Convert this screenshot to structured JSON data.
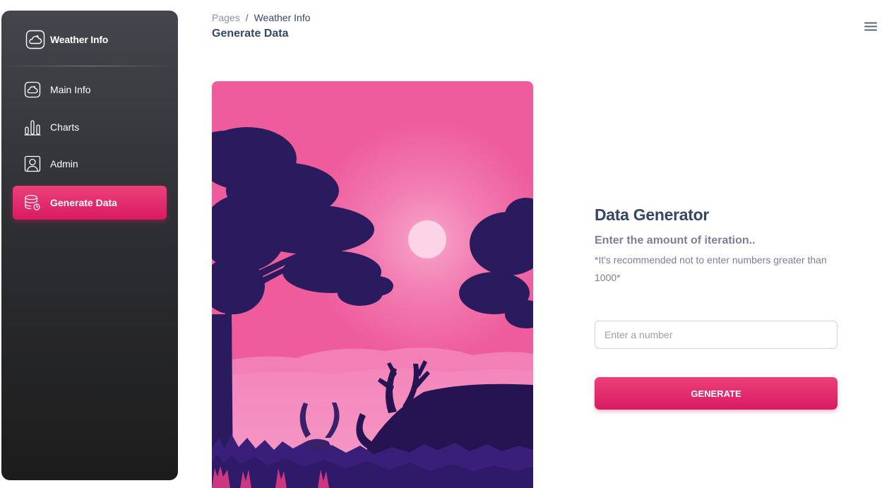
{
  "sidebar": {
    "brand": {
      "label": "Weather Info",
      "icon": "cloud-sun-icon"
    },
    "items": [
      {
        "label": "Main Info",
        "icon": "cloud-icon",
        "active": false
      },
      {
        "label": "Charts",
        "icon": "bar-chart-icon",
        "active": false
      },
      {
        "label": "Admin",
        "icon": "user-icon",
        "active": false
      },
      {
        "label": "Generate Data",
        "icon": "database-icon",
        "active": true
      }
    ]
  },
  "header": {
    "breadcrumb": {
      "root": "Pages",
      "separator": "/",
      "current": "Weather Info"
    },
    "title": "Generate Data",
    "menu_icon": "hamburger-menu-icon"
  },
  "generator": {
    "title": "Data Generator",
    "subtitle": "Enter the amount of iteration..",
    "note": "*It's recommended not to enter numbers greater than 1000*",
    "input": {
      "placeholder": "Enter a number",
      "value": ""
    },
    "button_label": "GENERATE"
  },
  "colors": {
    "accent": "#e91e63",
    "text_dark": "#344767",
    "text_muted": "#7b809a",
    "art_sky": "#ee5c9b",
    "art_silhouette": "#2a1a5e"
  }
}
